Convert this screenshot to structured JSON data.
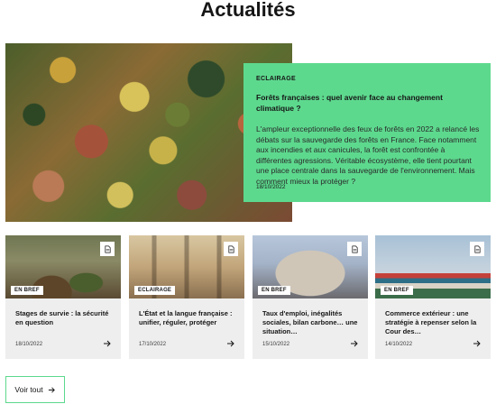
{
  "page": {
    "title": "Actualités"
  },
  "featured": {
    "tag": "ECLAIRAGE",
    "title": "Forêts françaises : quel avenir face au changement climatique ?",
    "description": "L'ampleur exceptionnelle des feux de forêts en 2022 a relancé les débats sur la sauvegarde des forêts en France. Face notamment aux incendies et aux canicules, la forêt est confrontée à différentes agressions. Véritable écosystème, elle tient pourtant une place centrale dans la sauvegarde de l'environnement. Mais comment mieux la protéger ?",
    "date": "18/10/2022",
    "image_icon": "forest-aerial-photo"
  },
  "cards": [
    {
      "tag": "EN BREF",
      "title": "Stages de survie : la sécurité en question",
      "date": "18/10/2022",
      "image_icon": "survival-camp-photo"
    },
    {
      "tag": "ECLAIRAGE",
      "title": "L'État et la langue française : unifier, réguler, protéger",
      "date": "17/10/2022",
      "image_icon": "building-photo"
    },
    {
      "tag": "EN BREF",
      "title": "Taux d'emploi, inégalités sociales, bilan carbone… une situation…",
      "date": "15/10/2022",
      "image_icon": "rotunda-building-photo"
    },
    {
      "tag": "EN BREF",
      "title": "Commerce extérieur : une stratégie à repenser selon la Cour des…",
      "date": "14/10/2022",
      "image_icon": "port-cranes-photo"
    }
  ],
  "more_button": {
    "label": "Voir tout"
  },
  "colors": {
    "accent": "#5dd98e",
    "card_bg": "#eeeeee",
    "text": "#161616"
  }
}
